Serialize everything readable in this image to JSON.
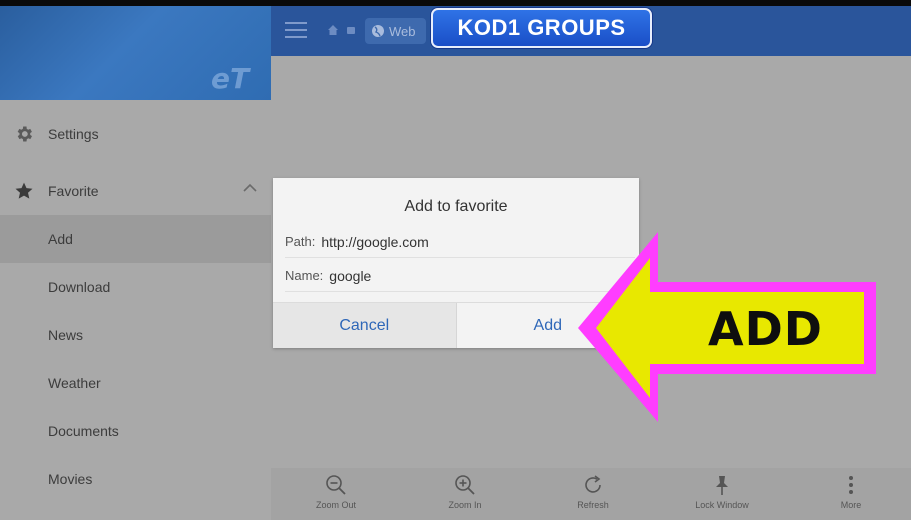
{
  "colors": {
    "header_blue": "#2a559b",
    "accent_link": "#2e67b8",
    "arrow_fill": "#e8e800",
    "arrow_border": "#ff3dff"
  },
  "sidebar": {
    "items": [
      {
        "label": "Settings",
        "icon": "gear-icon"
      },
      {
        "label": "Favorite",
        "icon": "star-icon"
      },
      {
        "label": "Add"
      },
      {
        "label": "Download"
      },
      {
        "label": "News"
      },
      {
        "label": "Weather"
      },
      {
        "label": "Documents"
      },
      {
        "label": "Movies"
      }
    ]
  },
  "header": {
    "breadcrumb": "Web"
  },
  "dialog": {
    "title": "Add to favorite",
    "path_label": "Path:",
    "path_value": "http://google.com",
    "name_label": "Name:",
    "name_value": "google",
    "cancel_label": "Cancel",
    "add_label": "Add"
  },
  "toolbar": {
    "zoom_out": "Zoom Out",
    "zoom_in": "Zoom In",
    "refresh": "Refresh",
    "lock_window": "Lock Window",
    "more": "More"
  },
  "overlay": {
    "badge_text": "KOD1 GROUPS",
    "arrow_text": "ADD"
  }
}
